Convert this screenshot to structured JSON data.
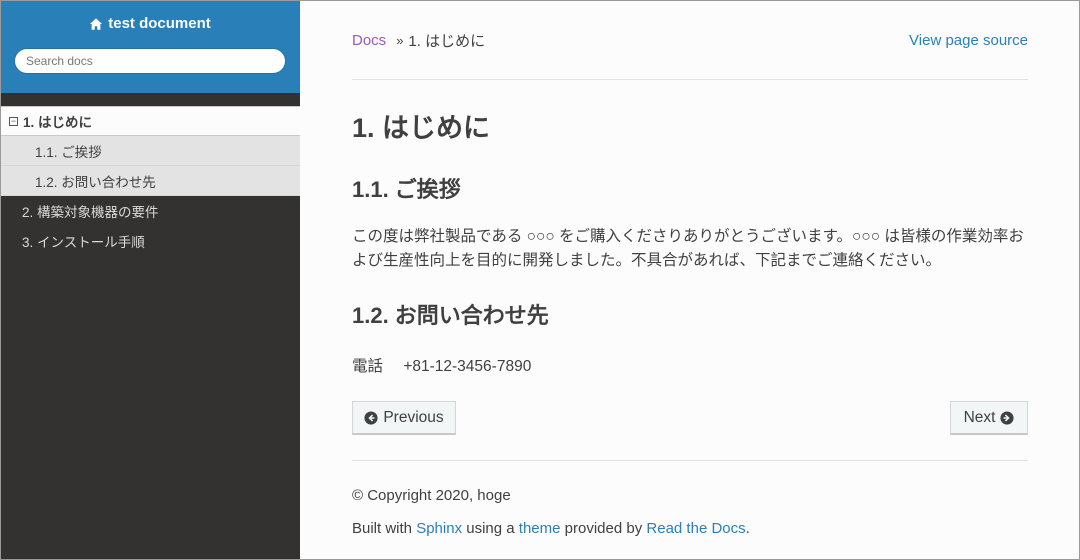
{
  "sidebar": {
    "project_title": "test document",
    "search_placeholder": "Search docs",
    "toggle_symbol": "−",
    "nav": {
      "current": "1. はじめに",
      "sub_items": [
        "1.1. ご挨拶",
        "1.2. お問い合わせ先"
      ],
      "items": [
        "2. 構築対象機器の要件",
        "3. インストール手順"
      ]
    }
  },
  "breadcrumbs": {
    "home": "Docs",
    "separator": "»",
    "current": "1. はじめに",
    "view_source": "View page source"
  },
  "content": {
    "title": "1. はじめに",
    "section1_heading": "1.1. ご挨拶",
    "section1_text": "この度は弊社製品である ○○○ をご購入くださりありがとうございます。○○○ は皆様の作業効率および生産性向上を目的に開発しました。不具合があれば、下記までご連絡ください。",
    "section2_heading": "1.2. お問い合わせ先",
    "tel_label": "電話",
    "tel_number": "+81-12-3456-7890"
  },
  "nav_buttons": {
    "previous": "Previous",
    "next": "Next"
  },
  "footer": {
    "copyright": "© Copyright 2020, hoge",
    "built_with": "Built with",
    "sphinx": "Sphinx",
    "using_a": "using a",
    "theme": "theme",
    "provided_by": "provided by",
    "rtd": "Read the Docs",
    "period": "."
  },
  "colors": {
    "brand_blue": "#2980b9",
    "sidebar_bg": "#343131",
    "link_visited": "#9b59b6",
    "text": "#404040"
  }
}
